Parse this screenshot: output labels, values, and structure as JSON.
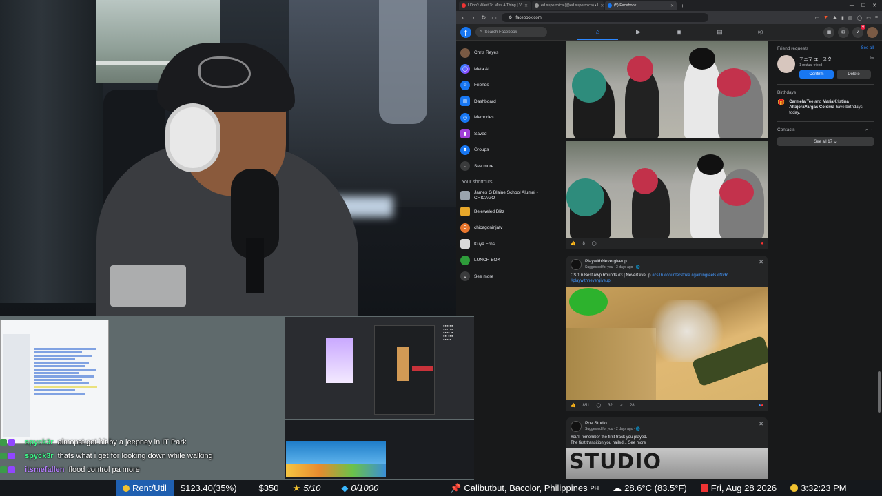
{
  "browser": {
    "tabs": [
      {
        "title": "I Don't Want To Miss A Thing | V",
        "active": false
      },
      {
        "title": "ed.supermica (@ed.supermica) • I",
        "active": false
      },
      {
        "title": "(5) Facebook",
        "active": true
      }
    ],
    "url": "facebook.com"
  },
  "facebook": {
    "logo": "f",
    "search_placeholder": "Search Facebook",
    "nav_icons": [
      "home-icon",
      "video-icon",
      "marketplace-icon",
      "groups-icon",
      "gaming-icon"
    ],
    "notification_count": "4",
    "left_nav": [
      {
        "label": "Chris Reyes",
        "icon": "avatar-icon"
      },
      {
        "label": "Meta AI",
        "icon": "meta-ai-icon"
      },
      {
        "label": "Friends",
        "icon": "friends-icon"
      },
      {
        "label": "Dashboard",
        "icon": "dashboard-icon"
      },
      {
        "label": "Memories",
        "icon": "memories-icon"
      },
      {
        "label": "Saved",
        "icon": "saved-icon"
      },
      {
        "label": "Groups",
        "icon": "groups-icon"
      },
      {
        "label": "See more",
        "icon": "chevron-down-icon"
      }
    ],
    "shortcuts_heading": "Your shortcuts",
    "shortcuts": [
      {
        "label": "James G Blaine School Alumni - CHICAGO",
        "color": "#9aa4ad"
      },
      {
        "label": "Bejeweled Blitz",
        "color": "#e7a72a"
      },
      {
        "label": "chicagoninjatv",
        "color": "#e8762d"
      },
      {
        "label": "Kuya Erns",
        "color": "#d9d9d9"
      },
      {
        "label": "LUNCH BOX",
        "color": "#2e9c3a"
      },
      {
        "label": "See more",
        "color": "#3a3b3c"
      }
    ],
    "photo_post": {
      "reactions": "8"
    },
    "post1": {
      "author": "PlaywithNevergiveup",
      "meta": "Suggested for you · 3 days ago · 🌐",
      "text_plain": "CS 1.6 Best Awp Rounds #3 | NeverGiveUp ",
      "text_tags": "#cs16 #counterstrike #gamingreels #NvR #playwithnevergiveup",
      "likes": "851",
      "comments": "32",
      "shares": "28"
    },
    "post2": {
      "author": "Poe Studio",
      "meta": "Suggested for you · 2 days ago · 🌐",
      "text": "You'll remember the first track you played.",
      "text2": "The first transition you nailed... See more",
      "image_text": "STUDIO"
    },
    "right": {
      "friend_requests_label": "Friend requests",
      "see_all": "See all",
      "request_name": "アニマ エースタ",
      "request_time": "1w",
      "request_mutual": "1 mutual friend",
      "confirm": "Confirm",
      "delete": "Delete",
      "birthdays_label": "Birthdays",
      "birthday_name1": "Carmela Tee",
      "birthday_and": " and ",
      "birthday_name2": "MariaKristina AlfajoraVargas Coloma",
      "birthday_suffix": " have birthdays today.",
      "contacts_label": "Contacts",
      "see_all_contacts": "See all 17 ⌄"
    }
  },
  "chat": [
    {
      "user": "spyck3r",
      "user_color": "#3cff8a",
      "message": "almopst got hit by a jeepney in IT Park"
    },
    {
      "user": "spyck3r",
      "user_color": "#3cff8a",
      "message": "thats what i get for looking down while walking"
    },
    {
      "user": "itsmefallen",
      "user_color": "#b57cff",
      "message": "flood control pa more"
    }
  ],
  "ticker": {
    "rent_label": "Rent/Util",
    "rent_value": "$123.40(35%)",
    "amount": "$350",
    "stars": "5/10",
    "gems": "0/1000",
    "location": "Calibutbut, Bacolor, Philippines",
    "country": "PH",
    "weather": "28.6°C (83.5°F)",
    "date": "Fri, Aug 28 2026",
    "time": "3:32:23 PM"
  }
}
